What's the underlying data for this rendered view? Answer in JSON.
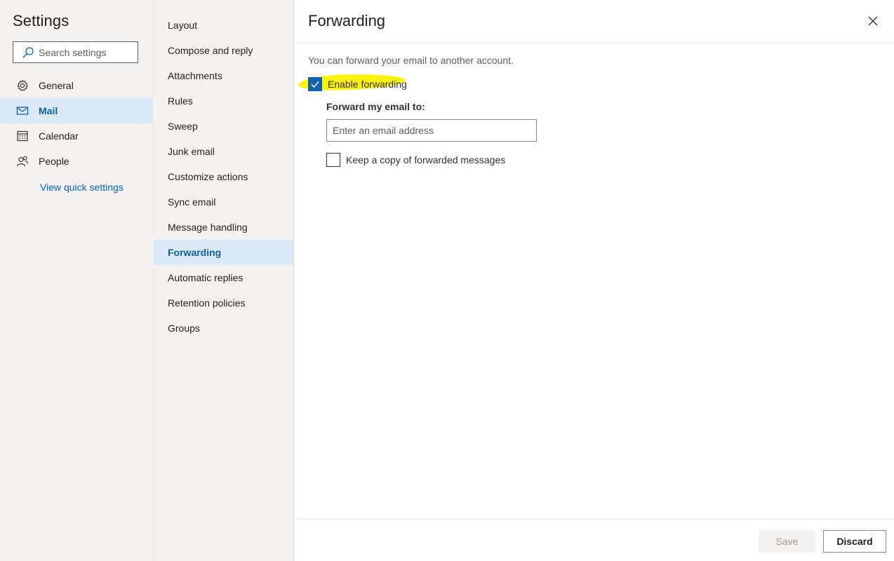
{
  "settings": {
    "title": "Settings",
    "search_placeholder": "Search settings",
    "nav": [
      {
        "label": "General",
        "icon": "gear-icon"
      },
      {
        "label": "Mail",
        "icon": "mail-icon",
        "active": true
      },
      {
        "label": "Calendar",
        "icon": "calendar-icon"
      },
      {
        "label": "People",
        "icon": "people-icon"
      }
    ],
    "quick_settings_link": "View quick settings"
  },
  "mail_categories": [
    "Layout",
    "Compose and reply",
    "Attachments",
    "Rules",
    "Sweep",
    "Junk email",
    "Customize actions",
    "Sync email",
    "Message handling",
    "Forwarding",
    "Automatic replies",
    "Retention policies",
    "Groups"
  ],
  "active_category": "Forwarding",
  "content": {
    "title": "Forwarding",
    "description": "You can forward your email to another account.",
    "enable_forwarding": {
      "label": "Enable forwarding",
      "checked": true
    },
    "forward_to_label": "Forward my email to:",
    "email_placeholder": "Enter an email address",
    "keep_copy": {
      "label": "Keep a copy of forwarded messages",
      "checked": false
    }
  },
  "footer": {
    "save_label": "Save",
    "discard_label": "Discard"
  },
  "colors": {
    "accent": "#0f62b0",
    "highlight": "#fff200",
    "nav_active_bg": "#dbe9f6",
    "pane_bg": "#f3f2f1"
  }
}
